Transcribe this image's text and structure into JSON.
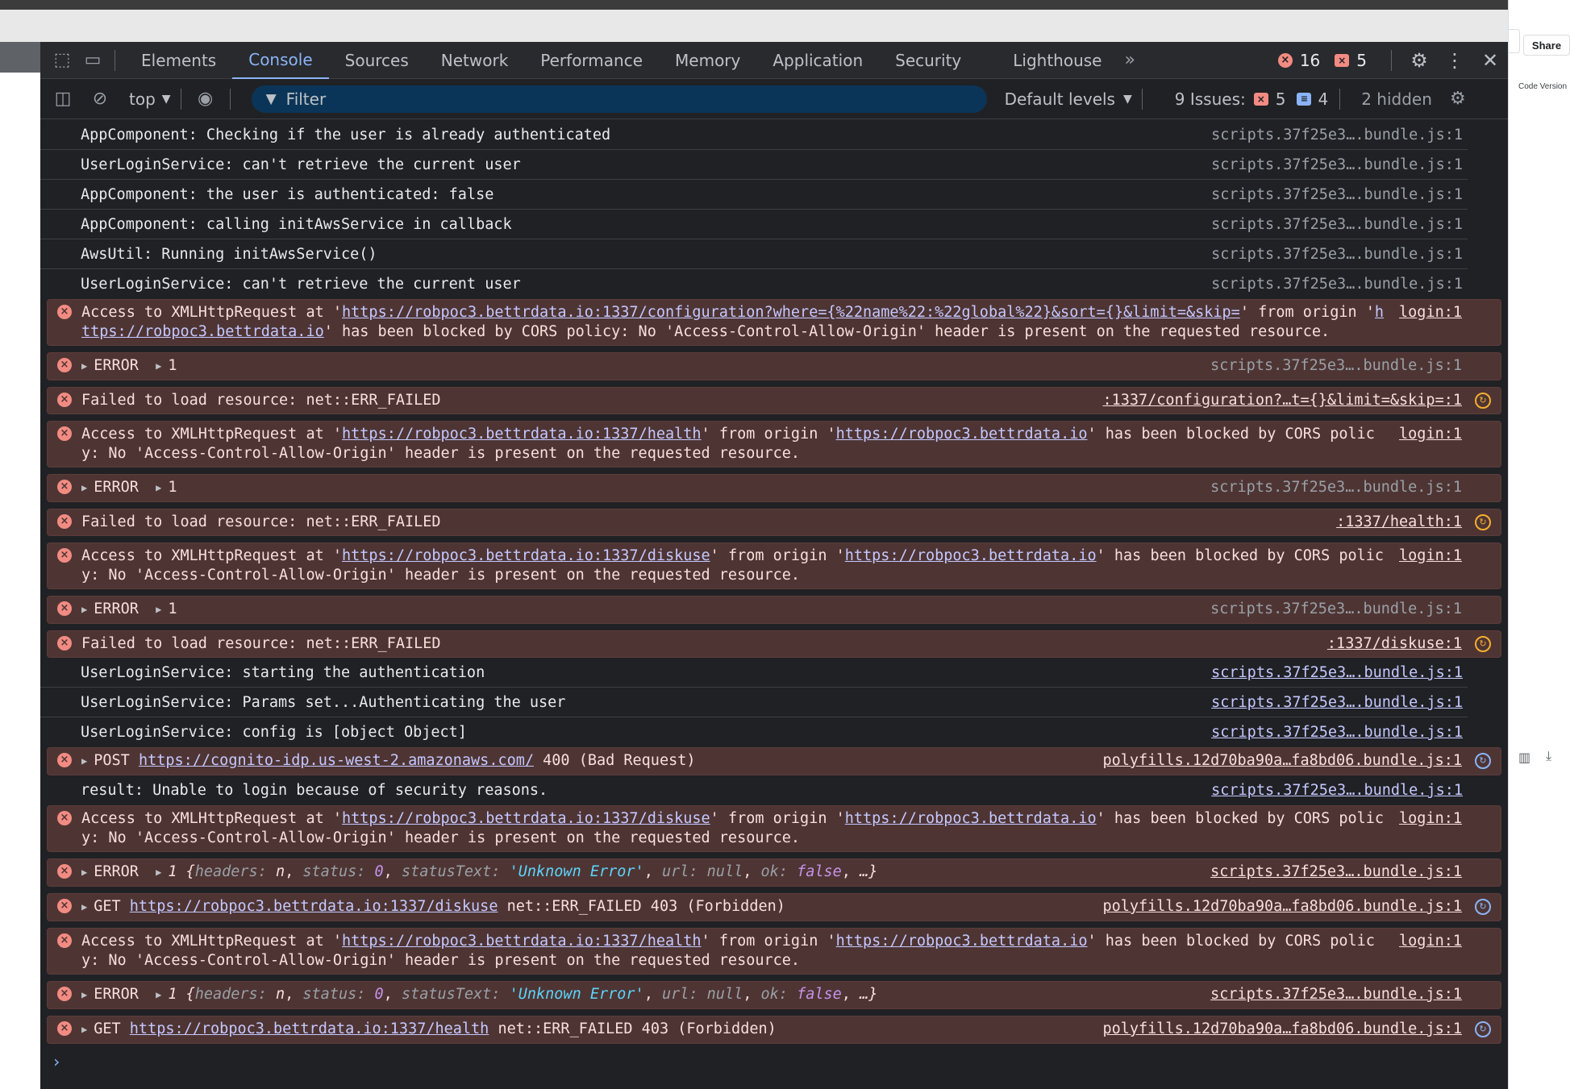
{
  "right_panel": {
    "share_label": "Share",
    "code_version_label": "Code Version"
  },
  "tabs": [
    {
      "label": "Elements"
    },
    {
      "label": "Console"
    },
    {
      "label": "Sources"
    },
    {
      "label": "Network"
    },
    {
      "label": "Performance"
    },
    {
      "label": "Memory"
    },
    {
      "label": "Application"
    },
    {
      "label": "Security"
    },
    {
      "label": "Lighthouse"
    }
  ],
  "counts": {
    "errors": "16",
    "issues_errors": "5"
  },
  "toolbar": {
    "context": "top",
    "filter_placeholder": "Filter",
    "levels": "Default levels",
    "issues_label": "9 Issues:",
    "issues_errors": "5",
    "issues_info": "4",
    "hidden": "2 hidden"
  },
  "messages": {
    "m1": {
      "text": "AppComponent: Checking if the user is already authenticated",
      "src": "scripts.37f25e3….bundle.js:1"
    },
    "m2": {
      "text": "UserLoginService: can't retrieve the current user",
      "src": "scripts.37f25e3….bundle.js:1"
    },
    "m3": {
      "text": "AppComponent: the user is authenticated: false",
      "src": "scripts.37f25e3….bundle.js:1"
    },
    "m4": {
      "text": "AppComponent: calling initAwsService in callback",
      "src": "scripts.37f25e3….bundle.js:1"
    },
    "m5": {
      "text": "AwsUtil: Running initAwsService()",
      "src": "scripts.37f25e3….bundle.js:1"
    },
    "m6": {
      "text": "UserLoginService: can't retrieve the current user",
      "src": "scripts.37f25e3….bundle.js:1"
    },
    "e1": {
      "pre": "Access to XMLHttpRequest at '",
      "url": "https://robpoc3.bettrdata.io:1337/configuration?where={%22name%22:%22global%22}&sort={}&limit=&skip=",
      "mid": "' from origin '",
      "origin": "https://robpoc3.bettrdata.io",
      "post": "' has been blocked by CORS policy: No 'Access-Control-Allow-Origin' header is present on the requested resource.",
      "src": "login:1"
    },
    "e2": {
      "label": "ERROR",
      "val": "1",
      "src": "scripts.37f25e3….bundle.js:1"
    },
    "e3": {
      "text": "Failed to load resource: net::ERR_FAILED",
      "src": ":1337/configuration?…t={}&limit=&skip=:1"
    },
    "e4": {
      "pre": "Access to XMLHttpRequest at '",
      "url": "https://robpoc3.bettrdata.io:1337/health",
      "mid": "' from origin '",
      "origin": "https://robpoc3.bettrdata.io",
      "post": "' has been blocked by CORS policy: No 'Access-Control-Allow-Origin' header is present on the requested resource.",
      "src": "login:1"
    },
    "e5": {
      "label": "ERROR",
      "val": "1",
      "src": "scripts.37f25e3….bundle.js:1"
    },
    "e6": {
      "text": "Failed to load resource: net::ERR_FAILED",
      "src": ":1337/health:1"
    },
    "e7": {
      "pre": "Access to XMLHttpRequest at '",
      "url": "https://robpoc3.bettrdata.io:1337/diskuse",
      "mid": "' from origin '",
      "origin": "https://robpoc3.bettrdata.io",
      "post": "' has been blocked by CORS policy: No 'Access-Control-Allow-Origin' header is present on the requested resource.",
      "src": "login:1"
    },
    "e8": {
      "label": "ERROR",
      "val": "1",
      "src": "scripts.37f25e3….bundle.js:1"
    },
    "e9": {
      "text": "Failed to load resource: net::ERR_FAILED",
      "src": ":1337/diskuse:1"
    },
    "m7": {
      "text": "UserLoginService: starting the authentication",
      "src": "scripts.37f25e3….bundle.js:1"
    },
    "m8": {
      "text": "UserLoginService: Params set...Authenticating the user",
      "src": "scripts.37f25e3….bundle.js:1"
    },
    "m9": {
      "text": "UserLoginService: config is [object Object]",
      "src": "scripts.37f25e3….bundle.js:1"
    },
    "e10": {
      "method": "POST",
      "url": "https://cognito-idp.us-west-2.amazonaws.com/",
      "status": "400 (Bad Request)",
      "src": "polyfills.12d70ba90a…fa8bd06.bundle.js:1"
    },
    "m10": {
      "text": "result: Unable to login because of security reasons.",
      "src": "scripts.37f25e3….bundle.js:1"
    },
    "e11": {
      "pre": "Access to XMLHttpRequest at '",
      "url": "https://robpoc3.bettrdata.io:1337/diskuse",
      "mid": "' from origin '",
      "origin": "https://robpoc3.bettrdata.io",
      "post": "' has been blocked by CORS policy: No 'Access-Control-Allow-Origin' header is present on the requested resource.",
      "src": "login:1"
    },
    "e12": {
      "label": "ERROR",
      "val": "1",
      "obj_open": "{",
      "k1": "headers:",
      "v1": "n",
      "k2": "status:",
      "v2": "0",
      "k3": "statusText:",
      "v3": "'Unknown Error'",
      "k4": "url:",
      "v4": "null",
      "k5": "ok:",
      "v5": "false",
      "obj_close": "…}",
      "src": "scripts.37f25e3….bundle.js:1"
    },
    "e13": {
      "method": "GET",
      "url": "https://robpoc3.bettrdata.io:1337/diskuse",
      "status": "net::ERR_FAILED 403 (Forbidden)",
      "src": "polyfills.12d70ba90a…fa8bd06.bundle.js:1"
    },
    "e14": {
      "pre": "Access to XMLHttpRequest at '",
      "url": "https://robpoc3.bettrdata.io:1337/health",
      "mid": "' from origin '",
      "origin": "https://robpoc3.bettrdata.io",
      "post": "' has been blocked by CORS policy: No 'Access-Control-Allow-Origin' header is present on the requested resource.",
      "src": "login:1"
    },
    "e15": {
      "label": "ERROR",
      "val": "1",
      "obj_open": "{",
      "k1": "headers:",
      "v1": "n",
      "k2": "status:",
      "v2": "0",
      "k3": "statusText:",
      "v3": "'Unknown Error'",
      "k4": "url:",
      "v4": "null",
      "k5": "ok:",
      "v5": "false",
      "obj_close": "…}",
      "src": "scripts.37f25e3….bundle.js:1"
    },
    "e16": {
      "method": "GET",
      "url": "https://robpoc3.bettrdata.io:1337/health",
      "status": "net::ERR_FAILED 403 (Forbidden)",
      "src": "polyfills.12d70ba90a…fa8bd06.bundle.js:1"
    }
  },
  "prompt_symbol": "›"
}
